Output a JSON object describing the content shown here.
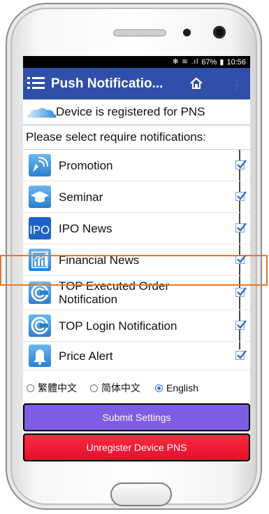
{
  "status_bar": {
    "icons": "✻ ≋",
    "signal": ".ıl",
    "battery": "67%",
    "time": "10:56"
  },
  "app_bar": {
    "title": "Push Notificatio...",
    "menu_icon": "menu-icon",
    "home_icon": "home-icon"
  },
  "registration": {
    "text": "Device is registered for PNS"
  },
  "prompt": "Please select require notifications:",
  "notifications": [
    {
      "label": "Promotion",
      "checked": true,
      "icon": "satellite-icon"
    },
    {
      "label": "Seminar",
      "checked": true,
      "icon": "graduation-cap-icon"
    },
    {
      "label": "IPO News",
      "checked": true,
      "icon": "ipo-icon"
    },
    {
      "label": "Financial News",
      "checked": true,
      "icon": "chart-icon"
    },
    {
      "label": "TOP Executed Order Notification",
      "checked": true,
      "icon": "top-logo-icon"
    },
    {
      "label": "TOP Login Notification",
      "checked": true,
      "icon": "top-logo-icon"
    },
    {
      "label": "Price Alert",
      "checked": true,
      "icon": "bell-icon"
    }
  ],
  "languages": {
    "options": [
      "繁體中文",
      "简体中文",
      "English"
    ],
    "selected": "English"
  },
  "buttons": {
    "submit": "Submit Settings",
    "unregister": "Unregister Device PNS"
  },
  "colors": {
    "app_bar": "#2f4fa8",
    "submit": "#7d5de3",
    "unregister": "#f01a33",
    "highlight": "#e87722"
  }
}
